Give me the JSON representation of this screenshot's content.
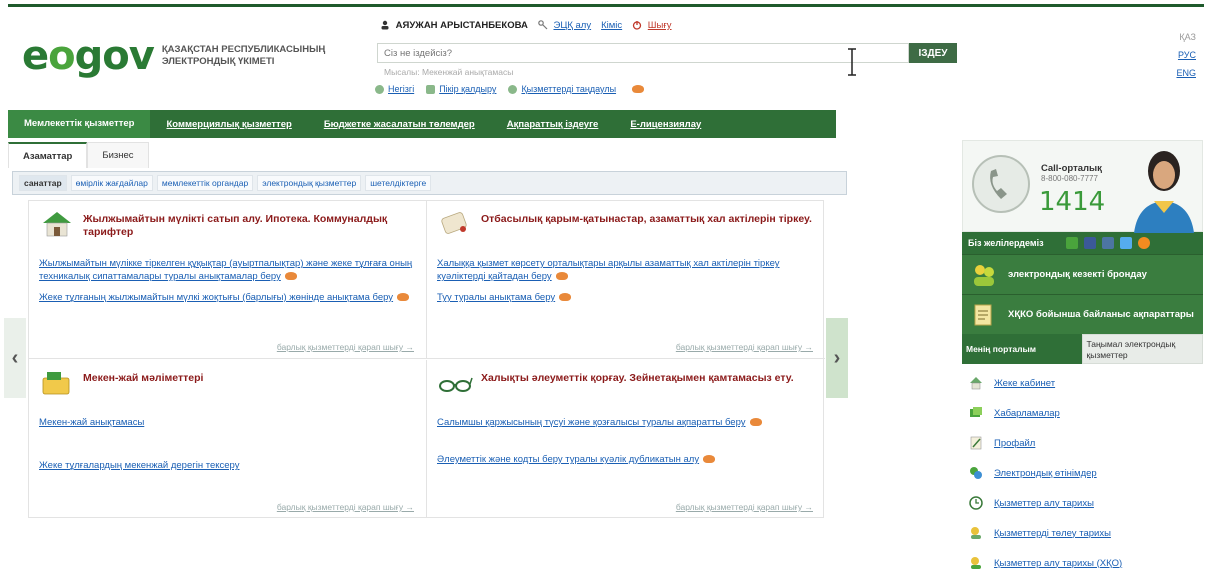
{
  "header": {
    "logo_text": "e.gov",
    "logo_caption": "ҚАЗАҚСТАН РЕСПУБЛИКАСЫНЫҢ ЭЛЕКТРОНДЫҚ ҮКІМЕТІ",
    "user_name": "АЯУЖАН АРЫСТАНБЕКОВА",
    "user_links": [
      "ЭЦҚ алу",
      "Кіміс",
      "Шығу"
    ],
    "search": {
      "placeholder": "Сіз не іздейсіз?",
      "hint": "Мысалы: Мекенжай анықтамасы",
      "button": "ІЗДЕУ"
    },
    "quick_links": [
      "Негізгі",
      "Пікір қалдыру",
      "Қызметтерді таңдаулы"
    ],
    "languages": [
      "ҚАЗ",
      "РУС",
      "ENG"
    ]
  },
  "main_nav": [
    "Мемлекеттік қызметтер",
    "Коммерциялық қызметтер",
    "Бюджетке жасалатын төлемдер",
    "Ақпараттық іздеуге",
    "Е-лицензиялау"
  ],
  "sub_tabs": [
    "Азаматтар",
    "Бизнес"
  ],
  "categories": [
    "санаттар",
    "өмірлік жағдайлар",
    "мемлекеттік органдар",
    "электрондық қызметтер",
    "шетелдіктерге"
  ],
  "services": [
    {
      "title": "Жылжымайтын мүлікті сатып алу. Ипотека. Коммуналдық тарифтер",
      "items": [
        "Жылжымайтын мүлікке тіркелген құқықтар (ауыртпалықтар) және жеке тұлғаға оның техникалық сипаттамалары туралы анықтамалар беру",
        "Жеке тұлғаның жылжымайтын мүлкі жоқтығы (барлығы) жөнінде анықтама беру"
      ],
      "all_link": "барлық қызметтерді қарап шығу →"
    },
    {
      "title": "Отбасылық қарым-қатынастар, азаматтық хал актілерін тіркеу.",
      "items": [
        "Халыққа қызмет көрсету орталықтары арқылы азаматтық хал актілерін тіркеу куәліктерді қайтадан беру",
        "Туу туралы анықтама беру"
      ],
      "all_link": "барлық қызметтерді қарап шығу →"
    },
    {
      "title": "Мекен-жай мәліметтері",
      "items": [
        "Мекен-жай анықтамасы",
        "Жеке тұлғалардың мекенжай дерегін тексеру"
      ],
      "all_link": "барлық қызметтерді қарап шығу →"
    },
    {
      "title": "Халықты әлеуметтік қорғау. Зейнетақымен қамтамасыз ету.",
      "items": [
        "Салымшы қаржысының түсуі және қозғалысы туралы ақпаратты беру",
        "Әлеуметтік және кодты беру туралы куәлік дубликатын алу"
      ],
      "all_link": "барлық қызметтерді қарап шығу →"
    }
  ],
  "right": {
    "call_title": "Call-орталық",
    "call_phone": "8-800-080-7777",
    "call_number": "1414",
    "social_label": "Біз желілердеміз",
    "promos": [
      "электрондық кезекті брондау",
      "ХҚКО бойынша байланыс ақпараттары"
    ],
    "portal_tabs": [
      "Менің порталым",
      "Таңымал электрондық қызметтер"
    ],
    "portal_links": [
      "Жеке кабинет",
      "Хабарламалар",
      "Профайл",
      "Электрондық өтінімдер",
      "Қызметтер алу тарихы",
      "Қызметтерді төлеу тарихы",
      "Қызметтер алу тарихы (ХҚО)"
    ]
  }
}
